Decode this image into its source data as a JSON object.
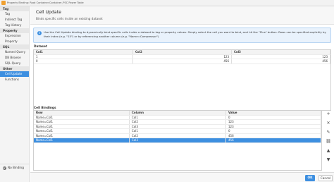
{
  "window": {
    "title": "Property Binding: Root Container.Container_PSC Power Table"
  },
  "sidebar": {
    "groups": [
      {
        "label": "Tag",
        "items": [
          "Tag",
          "Indirect Tag",
          "Tag History"
        ]
      },
      {
        "label": "Property",
        "items": [
          "Expression",
          "Property"
        ]
      },
      {
        "label": "SQL",
        "items": [
          "Named Query",
          "DB Browse",
          "SQL Query"
        ]
      },
      {
        "label": "Other",
        "items": [
          "Cell Update",
          "Functions"
        ]
      }
    ],
    "selected": "Cell Update",
    "no_binding": "No Binding"
  },
  "header": {
    "title": "Cell Update",
    "subtitle": "Binds specific cells inside an existing dataset"
  },
  "info": {
    "text": "Use the Cell Update binding to dynamically bind specific cells inside a dataset to tag or property values. Simply select the cell you want to bind, and hit the \"Plus\" button. Rows can be specified explicitly by their index (e.g. \"15\") or by referencing another column (e.g. \"Name=Compressor\")"
  },
  "dataset": {
    "label": "Dataset",
    "columns": [
      "Col1",
      "Col2",
      "Col3"
    ],
    "rows": [
      [
        "1",
        "123",
        "123"
      ],
      [
        "0",
        "456",
        "456"
      ]
    ]
  },
  "cell_bindings": {
    "label": "Cell Bindings",
    "columns": [
      "Row",
      "Column",
      "Value"
    ],
    "rows": [
      [
        "Name=Col1",
        "Col1",
        "0"
      ],
      [
        "Name=Col1",
        "Col2",
        "123"
      ],
      [
        "Name=Col1",
        "Col3",
        "123"
      ],
      [
        "Name=Col1",
        "Col1",
        "0"
      ],
      [
        "Name=Col1",
        "Col2",
        "456"
      ],
      [
        "Name=Col1",
        "Col3",
        "456"
      ]
    ],
    "selected_row": 5
  },
  "tools": [
    {
      "icon": "add-icon",
      "glyph": "+"
    },
    {
      "icon": "delete-icon",
      "glyph": "✕"
    },
    {
      "icon": "edit-icon",
      "glyph": "✎"
    },
    {
      "icon": "link-icon",
      "glyph": "⛓"
    },
    {
      "icon": "move-up-icon",
      "glyph": "▲"
    },
    {
      "icon": "move-down-icon",
      "glyph": "▼"
    }
  ],
  "footer": {
    "ok_label": "OK",
    "cancel_label": "Cancel"
  },
  "colors": {
    "accent": "#3d8fe0",
    "info_bg": "#e9f2fc"
  }
}
